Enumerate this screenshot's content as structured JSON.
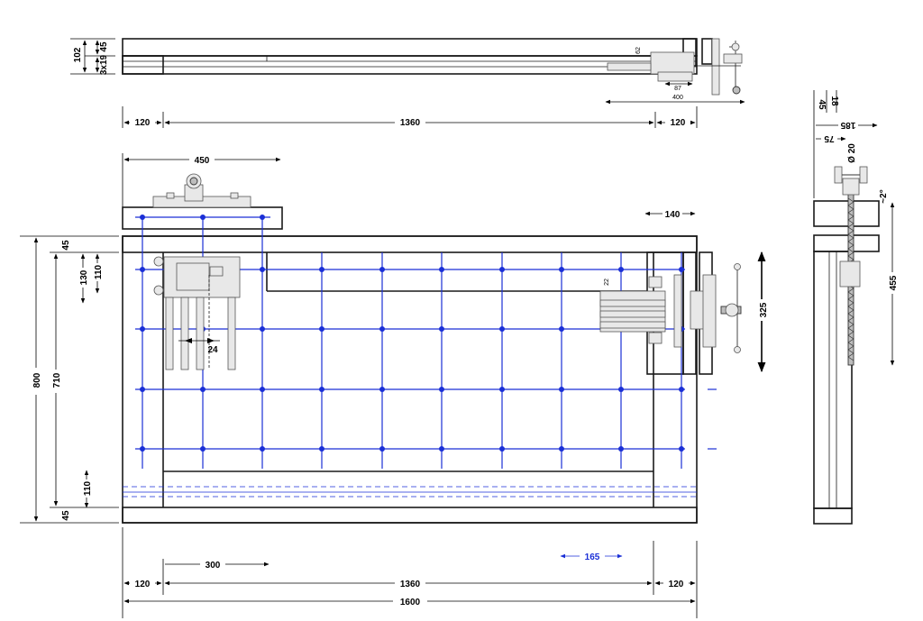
{
  "colors": {
    "wood_light": "#fbd9cb",
    "wood_pale": "#fef2ec",
    "wood_orange": "#ec8c5d",
    "wood_dark": "#d9541d",
    "grid_blue": "#1a2fd6",
    "outline": "#1a1a1a"
  },
  "top_view": {
    "dim_102": "102",
    "dim_45": "45",
    "dim_3x19": "3x19",
    "dim_62": "62",
    "dim_87": "87",
    "dim_400": "400",
    "dim_120_left": "120",
    "dim_1360": "1360",
    "dim_120_right": "120"
  },
  "plan_view": {
    "dim_450": "450",
    "dim_140": "140",
    "dim_325": "325",
    "dim_22": "22",
    "dim_24": "24",
    "dim_800": "800",
    "dim_710": "710",
    "dim_45_top": "45",
    "dim_130": "130",
    "dim_110_top": "110",
    "dim_110_bottom": "110",
    "dim_45_bottom": "45",
    "dim_300": "300",
    "dim_165": "165",
    "dim_120_left": "120",
    "dim_1360": "1360",
    "dim_120_right": "120",
    "dim_1600": "1600"
  },
  "side_view": {
    "dim_18": "18",
    "dim_45": "45",
    "dim_185": "185",
    "dim_75": "75",
    "dim_d20": "Ø 20",
    "dim_2deg": "~2°",
    "dim_455": "455"
  }
}
